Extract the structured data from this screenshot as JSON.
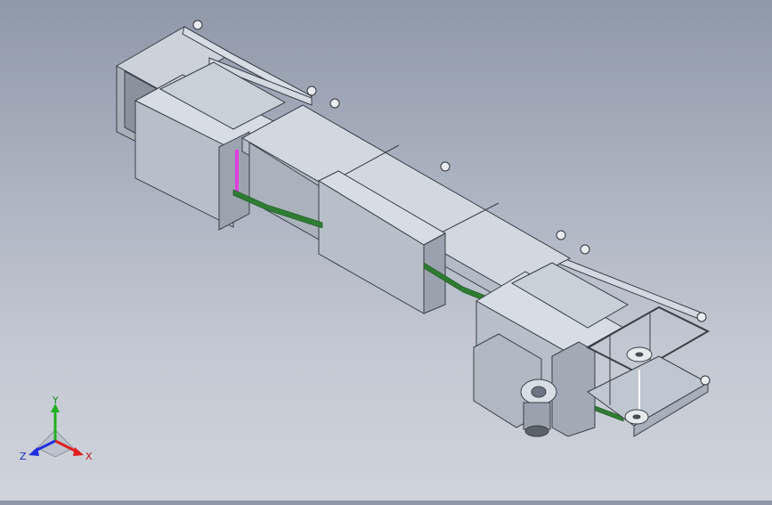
{
  "view": {
    "triad": {
      "x_label": "X",
      "y_label": "Y",
      "z_label": "Z"
    },
    "colors": {
      "background_top": "#8f98a8",
      "background_bottom": "#cfd3db",
      "panel_light": "#c6ced8",
      "panel_top": "#d6dde5",
      "panel_dark": "#9aa3ad",
      "edge": "#3a3f46",
      "belt": "#2e7d32",
      "magenta_part": "#e040e0",
      "axis_x": "#e02020",
      "axis_y": "#20b020",
      "axis_z": "#2030e0"
    }
  }
}
